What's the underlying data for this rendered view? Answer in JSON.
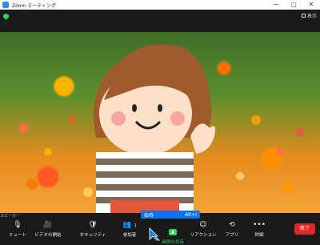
{
  "window": {
    "title": "Zoom ミーティング"
  },
  "topbar": {
    "view_label": "表示"
  },
  "toolbar": {
    "mute_label": "ミュート",
    "video_label": "ビデオの開始",
    "security_label": "セキュリティ",
    "participants_label": "参加者",
    "participants_count": "1",
    "share_label": "画面の共有",
    "reactions_label": "リアクション",
    "apps_label": "アプリ",
    "more_label": "詳細",
    "end_label": "終了"
  },
  "invite_popup": {
    "label": "招待",
    "shortcut": "Alt+I"
  },
  "status": {
    "text": "スピーカー"
  },
  "colors": {
    "accent": "#0e72ed",
    "share_green": "#23d959",
    "end_red": "#e02828"
  }
}
